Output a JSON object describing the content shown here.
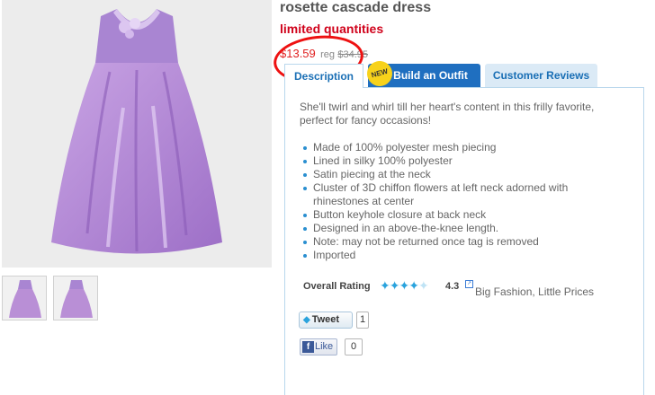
{
  "product": {
    "title": "rosette cascade dress",
    "limited_text": "limited quantities",
    "sale_price": "$13.59",
    "reg_label": "reg",
    "reg_price": "$34.95"
  },
  "tabs": [
    {
      "label": "Description",
      "active": true
    },
    {
      "label": "Build an Outfit",
      "badge": "NEW"
    },
    {
      "label": "Customer Reviews"
    }
  ],
  "description": {
    "intro": "She'll twirl and whirl till her heart's content in this frilly favorite, perfect for fancy occasions!",
    "features": [
      "Made of 100% polyester mesh piecing",
      "Lined in silky 100% polyester",
      "Satin piecing at the neck",
      "Cluster of 3D chiffon flowers at left neck adorned with rhinestones at center",
      "Button keyhole closure at back neck",
      "Designed in an above-the-knee length.",
      "Note: may not be returned once tag is removed",
      "Imported"
    ]
  },
  "rating": {
    "label": "Overall Rating",
    "value": "4.3",
    "stars_full": 4,
    "tagline": "Big Fashion, Little Prices"
  },
  "social": {
    "tweet_label": "Tweet",
    "tweet_count": "1",
    "like_label": "Like",
    "like_count": "0"
  },
  "colors": {
    "dress": "#b98fd6",
    "sale_price": "#e02020",
    "limited": "#d0021b",
    "tab_blue": "#1f6fc0",
    "annotation": "#ee1111"
  }
}
